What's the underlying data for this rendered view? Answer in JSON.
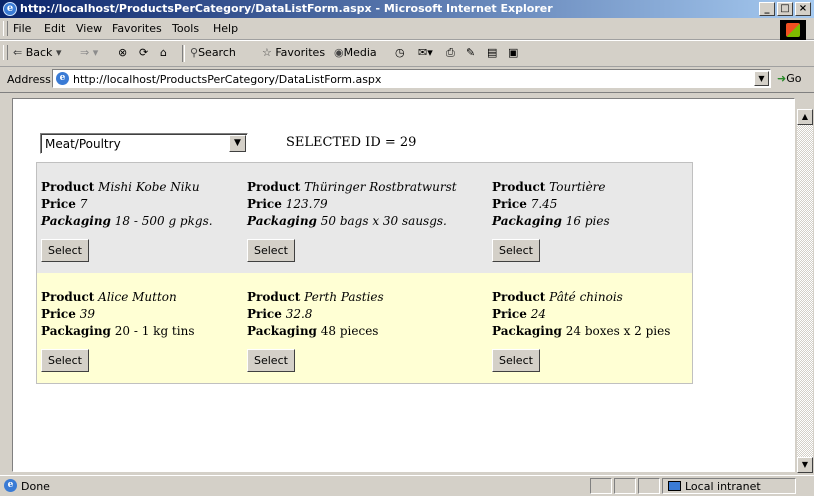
{
  "window": {
    "title": "http://localhost/ProductsPerCategory/DataListForm.aspx - Microsoft Internet Explorer",
    "minimize": "_",
    "maximize": "□",
    "close": "×"
  },
  "menu": {
    "file": "File",
    "edit": "Edit",
    "view": "View",
    "favorites": "Favorites",
    "tools": "Tools",
    "help": "Help"
  },
  "toolbar": {
    "back": "Back",
    "search": "Search",
    "favorites": "Favorites",
    "media": "Media"
  },
  "address": {
    "label": "Address",
    "url": "http://localhost/ProductsPerCategory/DataListForm.aspx",
    "go": "Go"
  },
  "page": {
    "category_select": "Meat/Poultry",
    "selected_id_text": "SELECTED ID = 29",
    "labels": {
      "product": "Product",
      "price": "Price",
      "packaging": "Packaging"
    },
    "rows": [
      [
        {
          "product": "Mishi Kobe Niku",
          "price": "7",
          "packaging": "18 - 500 g pkgs.",
          "select": "Select"
        },
        {
          "product": "Thüringer Rostbratwurst",
          "price": "123.79",
          "packaging": "50 bags x 30 sausgs.",
          "select": "Select"
        },
        {
          "product": "Tourtière",
          "price": "7.45",
          "packaging": "16 pies",
          "select": "Select"
        }
      ],
      [
        {
          "product": "Alice Mutton",
          "price": "39",
          "packaging": "20 - 1 kg tins",
          "select": "Select"
        },
        {
          "product": "Perth Pasties",
          "price": "32.8",
          "packaging": "48 pieces",
          "select": "Select"
        },
        {
          "product": "Pâté chinois",
          "price": "24",
          "packaging": "24 boxes x 2 pies",
          "select": "Select"
        }
      ]
    ]
  },
  "status": {
    "text": "Done",
    "zone": "Local intranet"
  }
}
